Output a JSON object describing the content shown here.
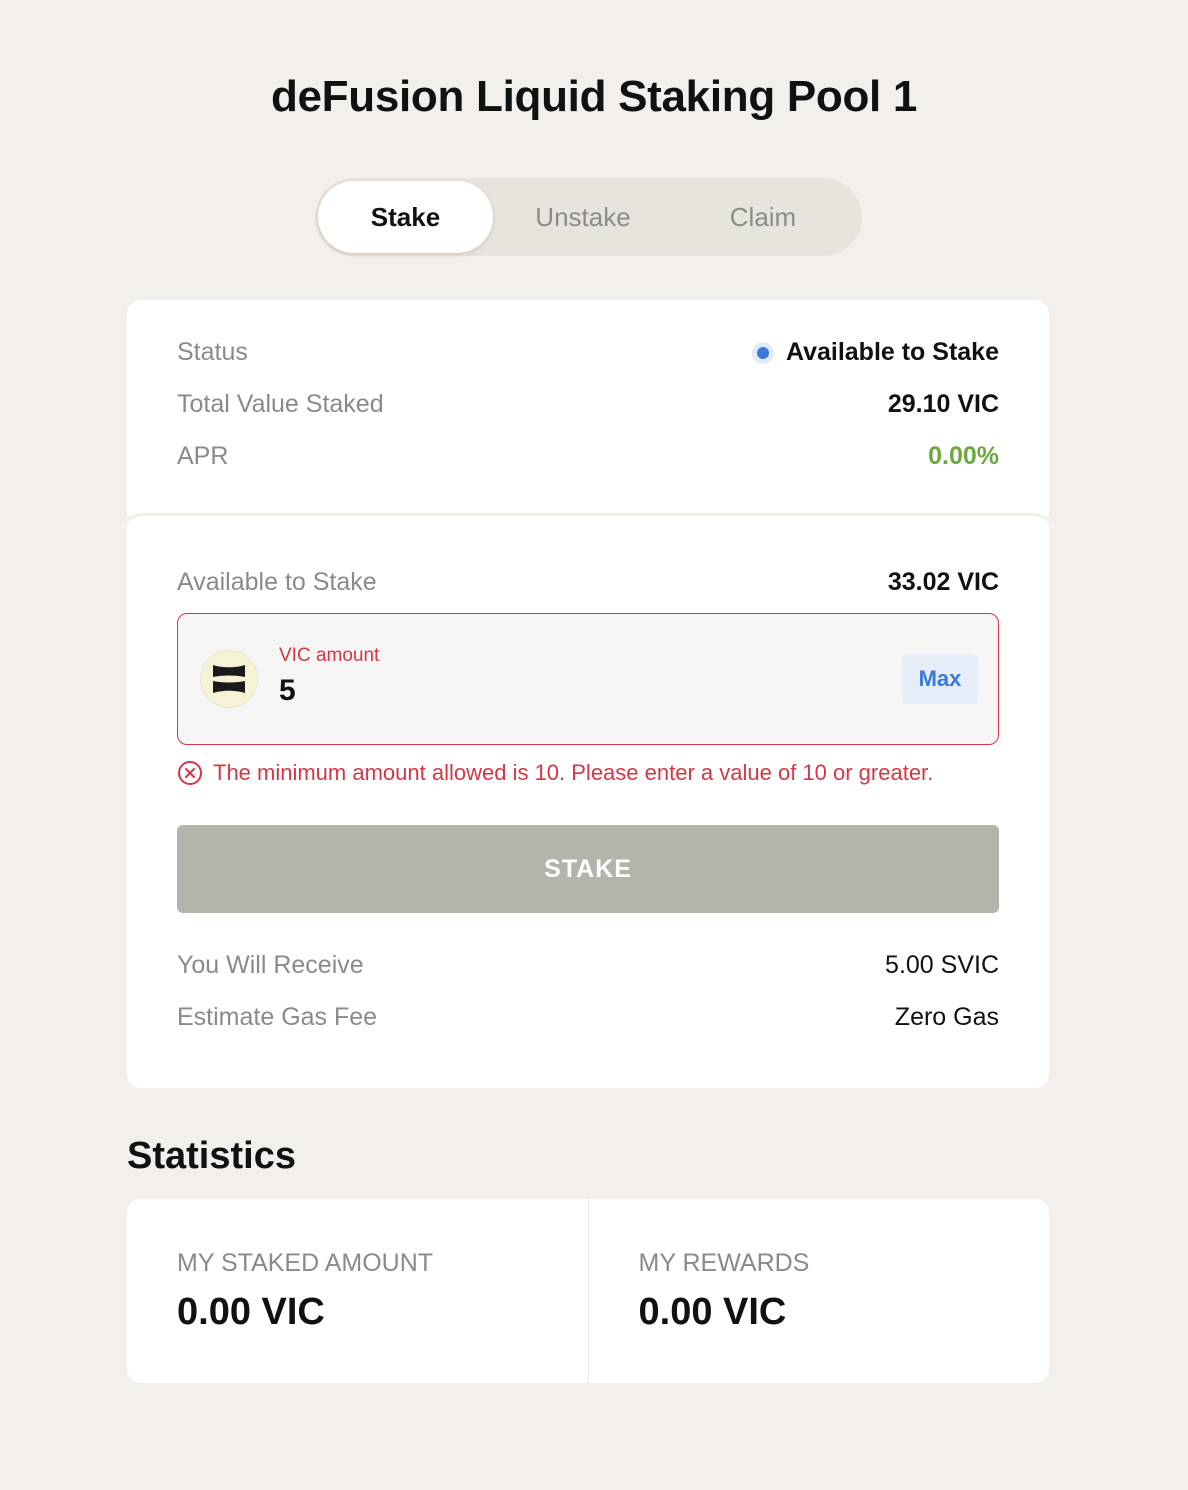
{
  "page": {
    "title": "deFusion Liquid Staking Pool 1"
  },
  "tabs": [
    {
      "label": "Stake",
      "active": true
    },
    {
      "label": "Unstake",
      "active": false
    },
    {
      "label": "Claim",
      "active": false
    }
  ],
  "pool_info": {
    "status_label": "Status",
    "status_value": "Available to Stake",
    "status_color": "#3b78d8",
    "tvs_label": "Total Value Staked",
    "tvs_value": "29.10 VIC",
    "apr_label": "APR",
    "apr_value": "0.00%",
    "apr_color": "#6aaa3d"
  },
  "stake_form": {
    "available_label": "Available to Stake",
    "available_value": "33.02 VIC",
    "token_icon": "vic-token-icon",
    "input_label": "VIC amount",
    "input_value": "5",
    "max_label": "Max",
    "error_icon": "error-circle-x-icon",
    "error_text": "The minimum amount allowed is 10. Please enter a value of 10 or greater.",
    "error_color": "#d63646",
    "submit_label": "STAKE",
    "receive_label": "You Will Receive",
    "receive_value": "5.00 SVIC",
    "gas_label": "Estimate Gas Fee",
    "gas_value": "Zero Gas"
  },
  "statistics": {
    "title": "Statistics",
    "items": [
      {
        "label": "MY STAKED AMOUNT",
        "value": "0.00 VIC"
      },
      {
        "label": "MY REWARDS",
        "value": "0.00 VIC"
      }
    ]
  }
}
